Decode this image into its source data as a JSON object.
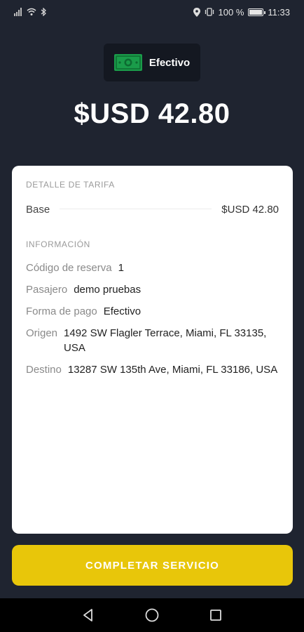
{
  "status_bar": {
    "left_icons": [
      "signal-icon",
      "wifi-icon",
      "bluetooth-icon"
    ],
    "right_icons": [
      "location-icon",
      "vibrate-icon"
    ],
    "battery_text": "100 %",
    "time": "11:33",
    "battery_level": 1.0
  },
  "payment": {
    "icon": "cash-icon",
    "label": "Efectivo",
    "accent_color": "#1a9c4a"
  },
  "amount": "$USD 42.80",
  "fare_detail": {
    "title": "DETALLE DE TARIFA",
    "base_label": "Base",
    "base_value": "$USD 42.80"
  },
  "info": {
    "title": "INFORMACIÓN",
    "rows": [
      {
        "key": "Código de reserva",
        "value": "1"
      },
      {
        "key": "Pasajero",
        "value": "demo pruebas"
      },
      {
        "key": "Forma de pago",
        "value": "Efectivo"
      },
      {
        "key": "Origen",
        "value": "1492 SW Flagler Terrace, Miami, FL 33135, USA"
      },
      {
        "key": "Destino",
        "value": "13287 SW 135th Ave, Miami, FL 33186, USA"
      }
    ]
  },
  "complete_button": {
    "label": "COMPLETAR SERVICIO",
    "color": "#e8c60a"
  },
  "nav_bar": {
    "icons": [
      "back-icon",
      "home-icon",
      "recents-icon"
    ]
  }
}
